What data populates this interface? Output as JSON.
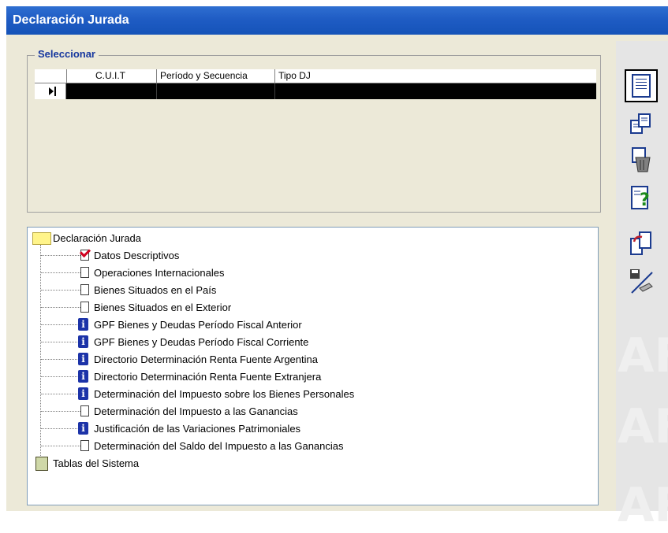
{
  "window": {
    "title": "Declaración Jurada"
  },
  "selector": {
    "label": "Seleccionar",
    "columns": [
      "C.U.I.T",
      "Período y Secuencia",
      "Tipo DJ"
    ]
  },
  "tree": {
    "root": "Declaración Jurada",
    "items": [
      {
        "label": "Datos Descriptivos",
        "icon": "check-icon"
      },
      {
        "label": "Operaciones Internacionales",
        "icon": "blank-doc-icon"
      },
      {
        "label": "Bienes Situados en el País",
        "icon": "blank-doc-icon"
      },
      {
        "label": "Bienes Situados en el Exterior",
        "icon": "blank-doc-icon"
      },
      {
        "label": "GPF Bienes y Deudas Período Fiscal Anterior",
        "icon": "info-icon"
      },
      {
        "label": "GPF Bienes y Deudas Período Fiscal Corriente",
        "icon": "info-icon"
      },
      {
        "label": "Directorio Determinación Renta Fuente Argentina",
        "icon": "info-icon"
      },
      {
        "label": "Directorio Determinación Renta Fuente Extranjera",
        "icon": "info-icon"
      },
      {
        "label": "Determinación del Impuesto sobre los Bienes Personales",
        "icon": "info-icon"
      },
      {
        "label": "Determinación del Impuesto a las Ganancias",
        "icon": "blank-doc-icon"
      },
      {
        "label": "Justificación de las Variaciones Patrimoniales",
        "icon": "info-icon"
      },
      {
        "label": "Determinación del Saldo del Impuesto a las Ganancias",
        "icon": "blank-doc-icon"
      }
    ],
    "second_root": "Tablas del Sistema"
  },
  "toolbar": {
    "buttons": [
      "document-list-icon",
      "copy-documents-icon",
      "trash-icon",
      "help-document-icon",
      "import-document-icon",
      "save-disk-icon"
    ]
  },
  "colors": {
    "title_bar": "#1f5cc4",
    "label_blue": "#15369e",
    "info_icon": "#1c33a8"
  }
}
